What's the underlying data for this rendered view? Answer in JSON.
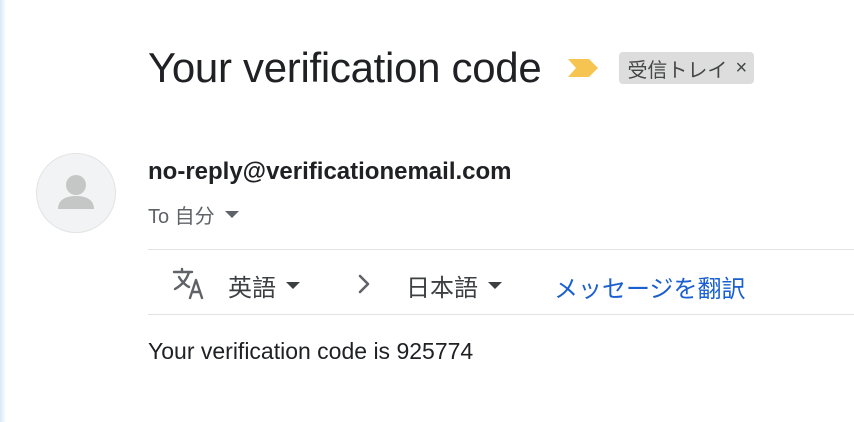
{
  "email": {
    "subject": "Your verification code",
    "label_chip": {
      "text": "受信トレイ",
      "close_symbol": "×"
    },
    "sender": "no-reply@verificationemail.com",
    "recipient": "To 自分",
    "body": "Your verification code is 925774"
  },
  "translation_bar": {
    "source_language": "英語",
    "target_language": "日本語",
    "translate_link": "メッセージを翻訳"
  },
  "colors": {
    "importance_marker": "#f5c451",
    "link": "#1a5fd0",
    "chip_background": "#dddddd"
  },
  "icons": {
    "importance": "importance-marker-icon",
    "avatar": "person-icon",
    "translate": "translate-icon",
    "arrow": "chevron-right-icon",
    "dropdown": "caret-down-icon"
  }
}
